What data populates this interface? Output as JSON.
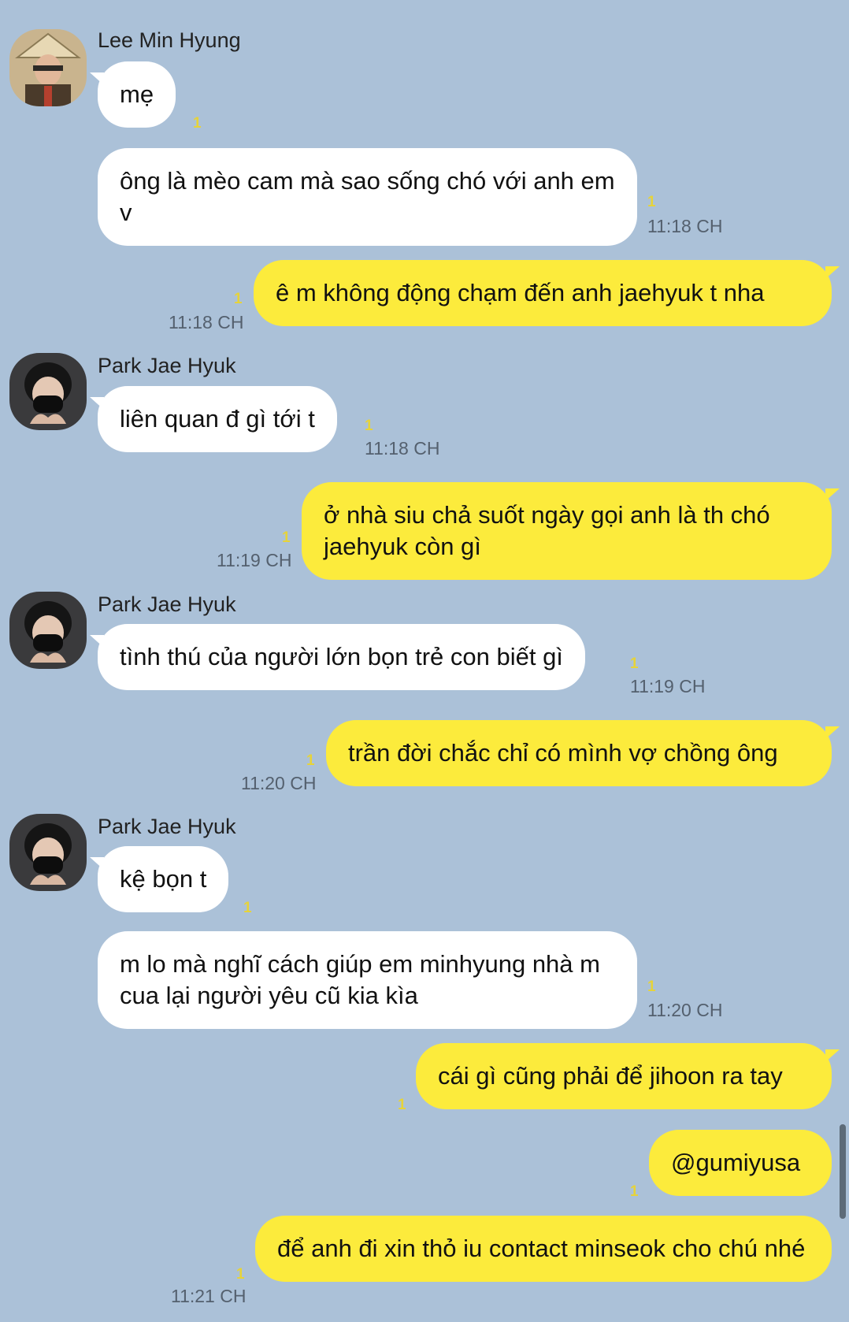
{
  "senders": {
    "lee": "Lee Min Hyung",
    "park": "Park Jae Hyuk"
  },
  "messages": [
    {
      "text": "mẹ",
      "unread": "1"
    },
    {
      "text": "ông là mèo cam mà sao sống chó với anh em v",
      "unread": "1",
      "time": "11:18 CH"
    },
    {
      "text": "ê m không động chạm đến anh jaehyuk t nha",
      "unread": "1",
      "time": "11:18 CH"
    },
    {
      "text": "liên quan đ gì tới t",
      "unread": "1",
      "time": "11:18 CH"
    },
    {
      "text": "ở nhà siu chả suốt ngày gọi anh là th chó jaehyuk còn gì",
      "unread": "1",
      "time": "11:19 CH"
    },
    {
      "text": "tình thú của người lớn bọn trẻ con biết gì",
      "unread": "1",
      "time": "11:19 CH"
    },
    {
      "text": "trần đời chắc chỉ có mình vợ chồng ông",
      "unread": "1",
      "time": "11:20 CH"
    },
    {
      "text": "kệ bọn t",
      "unread": "1"
    },
    {
      "text": "m lo mà nghĩ cách giúp em minhyung nhà m cua lại người yêu cũ kia kìa",
      "unread": "1",
      "time": "11:20 CH"
    },
    {
      "text": "cái gì cũng phải để jihoon ra tay",
      "unread": "1"
    },
    {
      "text": "@gumiyusa",
      "unread": "1"
    },
    {
      "text": "để anh đi xin thỏ iu contact minseok cho chú nhé",
      "unread": "1",
      "time": "11:21 CH"
    }
  ],
  "colors": {
    "background": "#abc1d8",
    "incoming_bubble": "#ffffff",
    "outgoing_bubble": "#fceb3c",
    "unread": "#e6d33a"
  },
  "icons": {
    "avatar_lee": "person-with-conical-hat-avatar",
    "avatar_park": "person-with-black-mask-avatar"
  }
}
